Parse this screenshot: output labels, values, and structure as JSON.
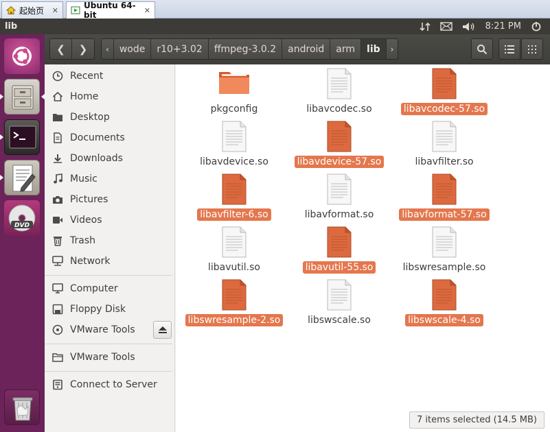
{
  "vm_tabs": [
    {
      "label": "起始页"
    },
    {
      "label": "Ubuntu 64-bit"
    }
  ],
  "panel": {
    "title": "lib",
    "clock": "8:21 PM"
  },
  "launcher": {
    "items": [
      "ubuntu-dash",
      "files",
      "terminal",
      "text-editor",
      "dvd",
      "trash"
    ]
  },
  "breadcrumbs": {
    "items": [
      "wode",
      "r10+3.02",
      "ffmpeg-3.0.2",
      "android",
      "arm",
      "lib"
    ],
    "current": "lib"
  },
  "sidebar": {
    "places": [
      {
        "label": "Recent",
        "icon": "clock-icon"
      },
      {
        "label": "Home",
        "icon": "home-icon"
      },
      {
        "label": "Desktop",
        "icon": "folder-icon"
      },
      {
        "label": "Documents",
        "icon": "document-icon"
      },
      {
        "label": "Downloads",
        "icon": "download-icon"
      },
      {
        "label": "Music",
        "icon": "music-icon"
      },
      {
        "label": "Pictures",
        "icon": "camera-icon"
      },
      {
        "label": "Videos",
        "icon": "video-icon"
      },
      {
        "label": "Trash",
        "icon": "trash-icon"
      },
      {
        "label": "Network",
        "icon": "network-icon"
      }
    ],
    "devices": [
      {
        "label": "Computer",
        "icon": "computer-icon"
      },
      {
        "label": "Floppy Disk",
        "icon": "floppy-icon"
      },
      {
        "label": "VMware Tools",
        "icon": "disc-icon"
      }
    ],
    "bookmarks": [
      {
        "label": "VMware Tools",
        "icon": "folder-icon"
      }
    ],
    "network": [
      {
        "label": "Connect to Server",
        "icon": "server-icon"
      }
    ]
  },
  "files": [
    {
      "name": "pkgconfig",
      "type": "folder",
      "selected": false
    },
    {
      "name": "libavcodec.so",
      "type": "file",
      "selected": false
    },
    {
      "name": "libavcodec-57.so",
      "type": "file",
      "selected": true
    },
    {
      "name": "libavdevice.so",
      "type": "file",
      "selected": false
    },
    {
      "name": "libavdevice-57.so",
      "type": "file",
      "selected": true
    },
    {
      "name": "libavfilter.so",
      "type": "file",
      "selected": false
    },
    {
      "name": "libavfilter-6.so",
      "type": "file",
      "selected": true
    },
    {
      "name": "libavformat.so",
      "type": "file",
      "selected": false
    },
    {
      "name": "libavformat-57.so",
      "type": "file",
      "selected": true
    },
    {
      "name": "libavutil.so",
      "type": "file",
      "selected": false
    },
    {
      "name": "libavutil-55.so",
      "type": "file",
      "selected": true
    },
    {
      "name": "libswresample.so",
      "type": "file",
      "selected": false
    },
    {
      "name": "libswresample-2.so",
      "type": "file",
      "selected": true
    },
    {
      "name": "libswscale.so",
      "type": "file",
      "selected": false
    },
    {
      "name": "libswscale-4.so",
      "type": "file",
      "selected": true
    }
  ],
  "status": "7 items selected (14.5 MB)",
  "colors": {
    "selection": "#e4774d",
    "launcher": "#6b2359",
    "panel": "#3c3b37"
  }
}
